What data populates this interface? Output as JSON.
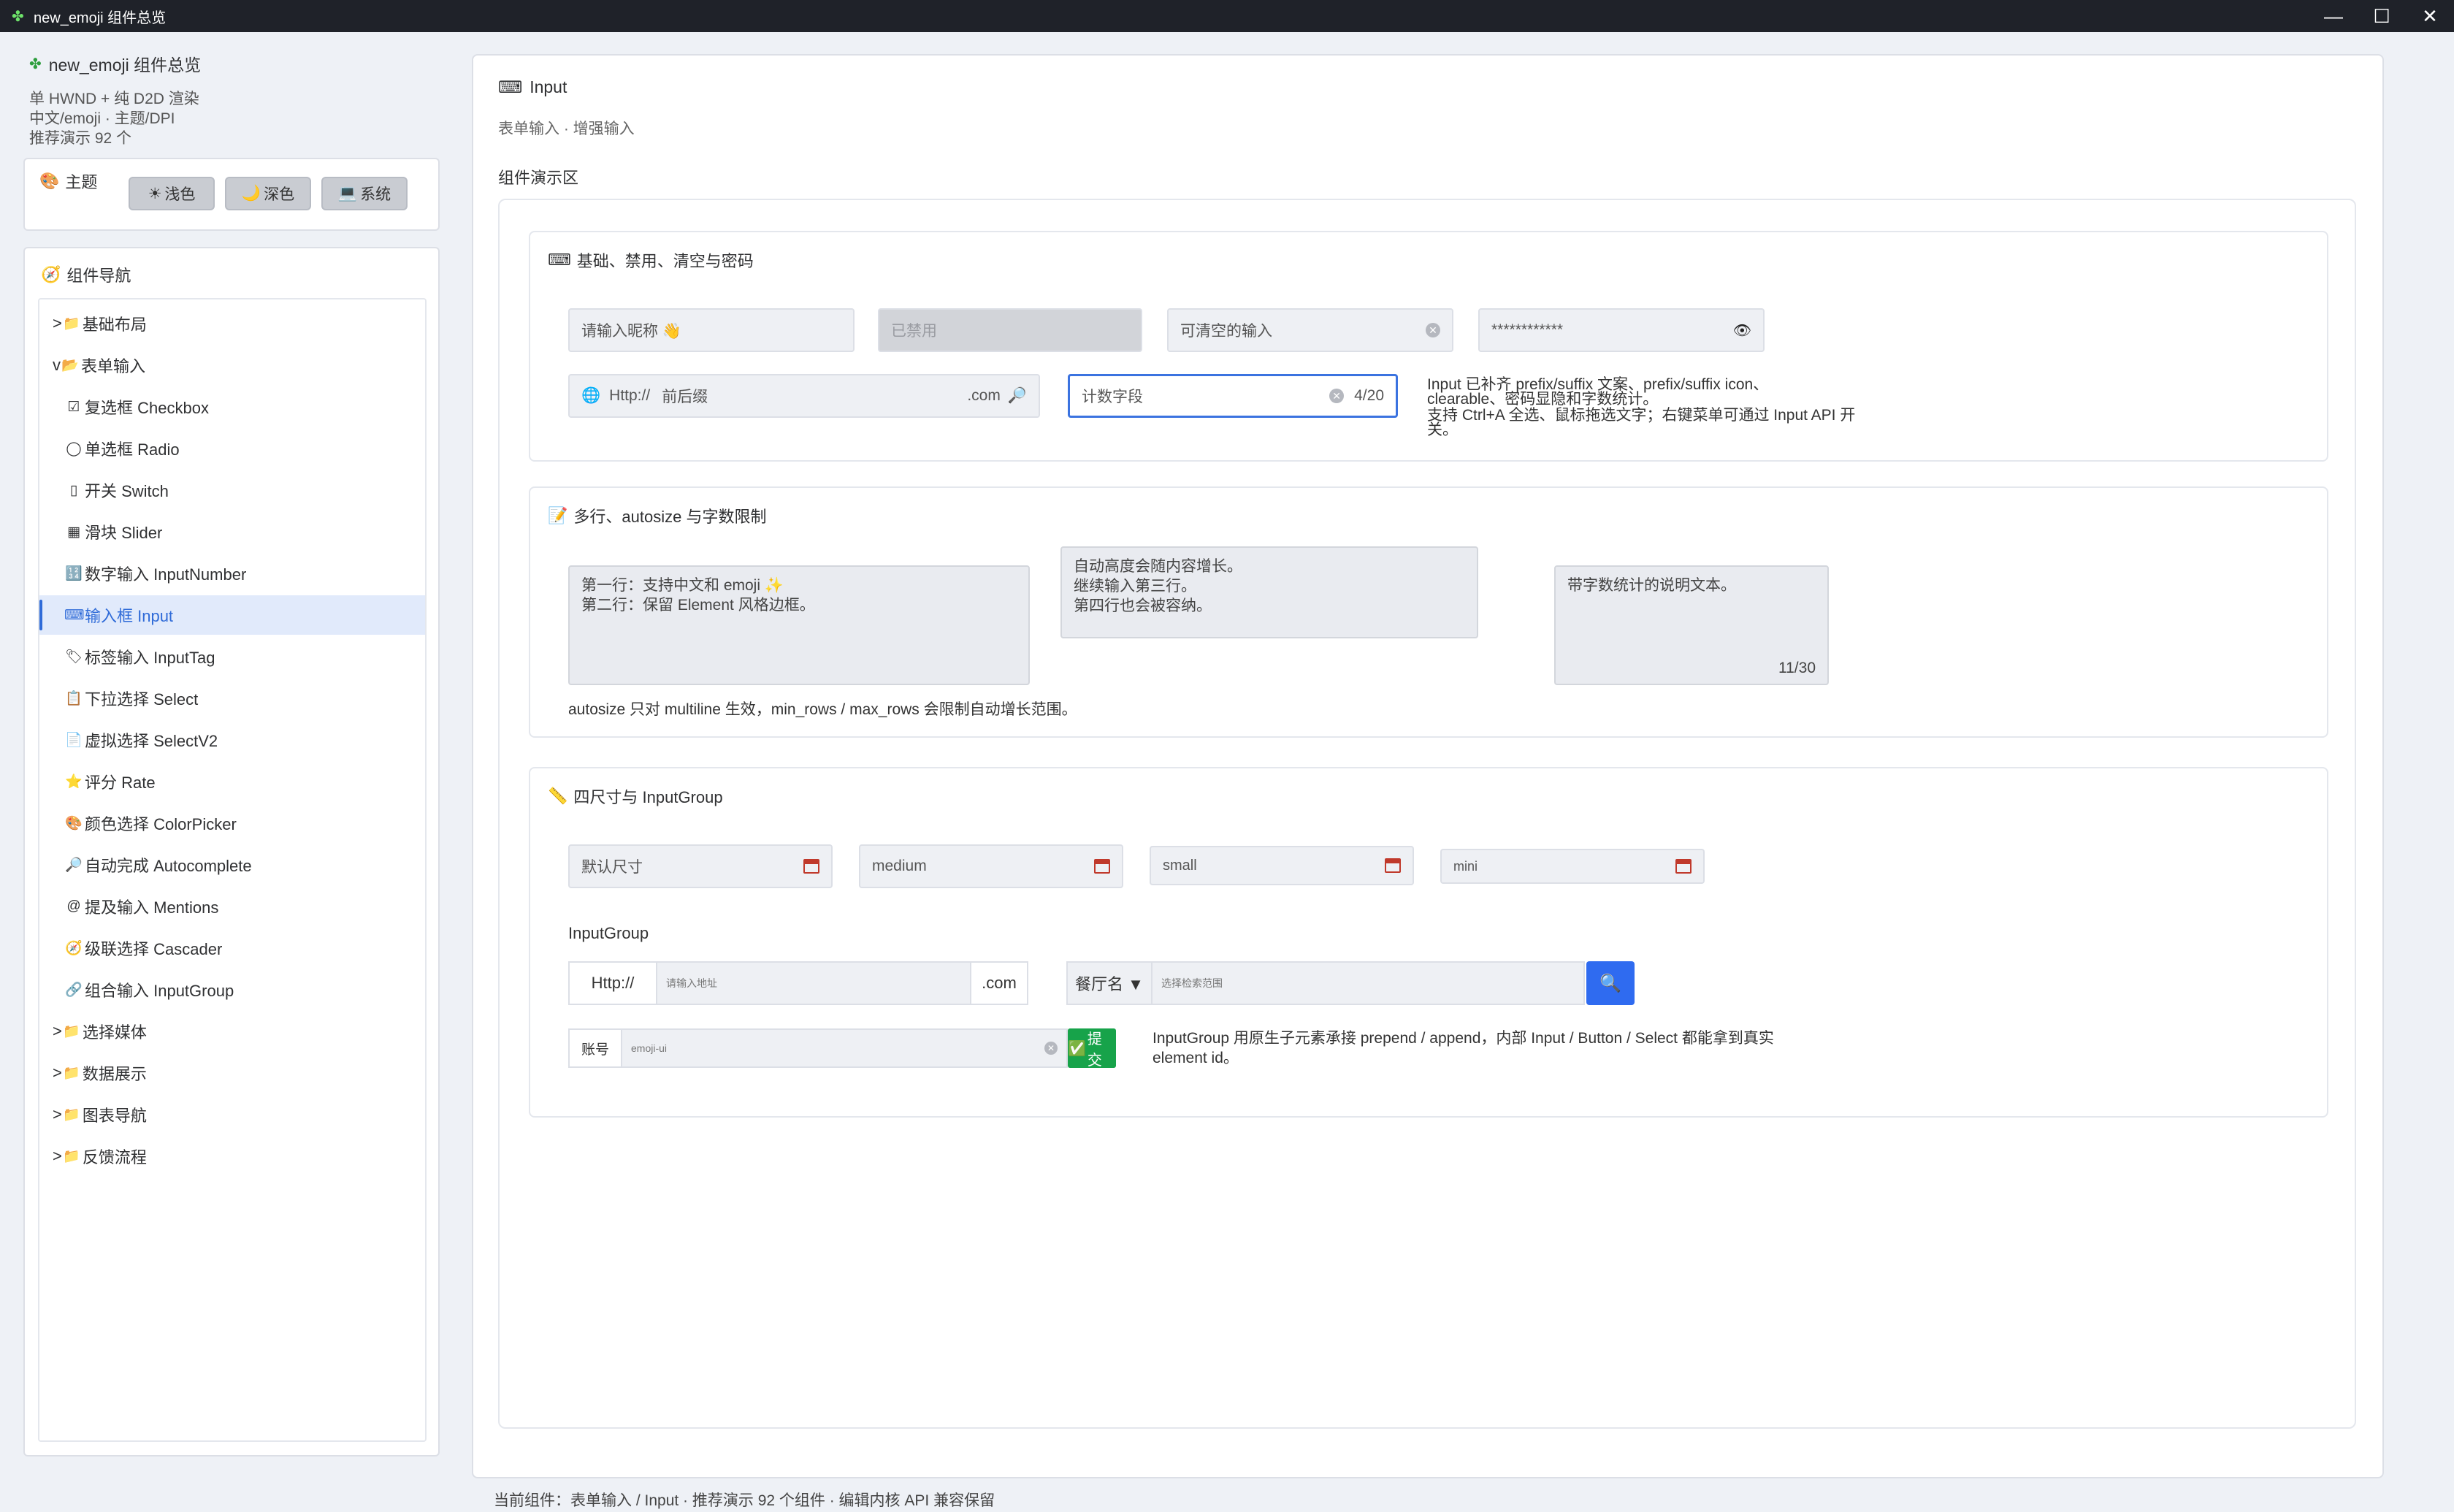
{
  "window": {
    "title": "new_emoji 组件总览",
    "icon": "clover-icon",
    "controls": [
      "—",
      "☐",
      "✕"
    ]
  },
  "sidebar": {
    "app_title": "new_emoji 组件总览",
    "sub_lines": [
      "单 HWND + 纯 D2D 渲染",
      "中文/emoji · 主题/DPI",
      "推荐演示 92 个"
    ],
    "theme_label": "主题",
    "theme_buttons": [
      {
        "label": "浅色",
        "icon": "☀"
      },
      {
        "label": "深色",
        "icon": "🌙"
      },
      {
        "label": "系统",
        "icon": "💻"
      }
    ],
    "nav_label": "组件导航",
    "nav_items": [
      {
        "label": "基础布局",
        "prefix": ">",
        "icon": "📁",
        "kind": "group"
      },
      {
        "label": "表单输入",
        "prefix": "v",
        "icon": "📂",
        "kind": "group"
      },
      {
        "label": "复选框 Checkbox",
        "icon": "☑",
        "kind": "child"
      },
      {
        "label": "单选框 Radio",
        "icon": "◯",
        "kind": "child"
      },
      {
        "label": "开关 Switch",
        "icon": "▯",
        "kind": "child"
      },
      {
        "label": "滑块 Slider",
        "icon": "▦",
        "kind": "child"
      },
      {
        "label": "数字输入 InputNumber",
        "icon": "🔢",
        "kind": "child"
      },
      {
        "label": "输入框 Input",
        "icon": "⌨",
        "kind": "child",
        "active": true
      },
      {
        "label": "标签输入 InputTag",
        "icon": "🏷",
        "kind": "child"
      },
      {
        "label": "下拉选择 Select",
        "icon": "📋",
        "kind": "child"
      },
      {
        "label": "虚拟选择 SelectV2",
        "icon": "📄",
        "kind": "child"
      },
      {
        "label": "评分 Rate",
        "icon": "⭐",
        "kind": "child"
      },
      {
        "label": "颜色选择 ColorPicker",
        "icon": "🎨",
        "kind": "child"
      },
      {
        "label": "自动完成 Autocomplete",
        "icon": "🔎",
        "kind": "child"
      },
      {
        "label": "提及输入 Mentions",
        "icon": "@",
        "kind": "child"
      },
      {
        "label": "级联选择 Cascader",
        "icon": "🧭",
        "kind": "child"
      },
      {
        "label": "组合输入 InputGroup",
        "icon": "🔗",
        "kind": "child"
      },
      {
        "label": "选择媒体",
        "prefix": ">",
        "icon": "📁",
        "kind": "group"
      },
      {
        "label": "数据展示",
        "prefix": ">",
        "icon": "📁",
        "kind": "group"
      },
      {
        "label": "图表导航",
        "prefix": ">",
        "icon": "📁",
        "kind": "group"
      },
      {
        "label": "反馈流程",
        "prefix": ">",
        "icon": "📁",
        "kind": "group"
      }
    ]
  },
  "main": {
    "title": "Input",
    "subtitle": "表单输入 · 增强输入",
    "demo_label": "组件演示区",
    "sec1": {
      "title": "基础、禁用、清空与密码",
      "nickname_placeholder": "请输入昵称 👋",
      "disabled_text": "已禁用",
      "clearable_text": "可清空的输入",
      "password_text": "************",
      "url_prefix": "Http://",
      "url_value": "前后缀",
      "url_suffix": ".com",
      "count_value": "计数字段",
      "count_text": "4/20",
      "note_lines": [
        "Input 已补齐 prefix/suffix 文案、prefix/suffix icon、",
        "clearable、密码显隐和字数统计。",
        "支持 Ctrl+A 全选、鼠标拖选文字；右键菜单可通过 Input API 开",
        "关。"
      ]
    },
    "sec2": {
      "title": "多行、autosize 与字数限制",
      "ta1_lines": [
        "第一行：支持中文和 emoji ✨",
        "第二行：保留 Element 风格边框。"
      ],
      "ta2_lines": [
        "自动高度会随内容增长。",
        "继续输入第三行。",
        "第四行也会被容纳。"
      ],
      "ta3_text": "带字数统计的说明文本。",
      "ta3_count": "11/30",
      "note": "autosize 只对 multiline 生效，min_rows / max_rows 会限制自动增长范围。"
    },
    "sec3": {
      "title": "四尺寸与 InputGroup",
      "sizes": [
        "默认尺寸",
        "medium",
        "small",
        "mini"
      ],
      "group_label": "InputGroup",
      "g1_prepend": "Http://",
      "g1_placeholder": "请输入地址",
      "g1_append": ".com",
      "g2_select": "餐厅名 ▼",
      "g2_placeholder": "选择检索范围",
      "g3_prepend": "账号",
      "g3_value": "emoji-ui",
      "g3_button": "提交",
      "note_lines": [
        "InputGroup 用原生子元素承接 prepend / append，内部 Input / Button / Select 都能拿到真实",
        "element id。"
      ]
    }
  },
  "status_bar": "当前组件：表单输入 / Input · 推荐演示 92 个组件 · 编辑内核 API 兼容保留",
  "colors": {
    "accent": "#2f6bd8",
    "titlebar": "#1f2229",
    "success": "#17a34a"
  }
}
